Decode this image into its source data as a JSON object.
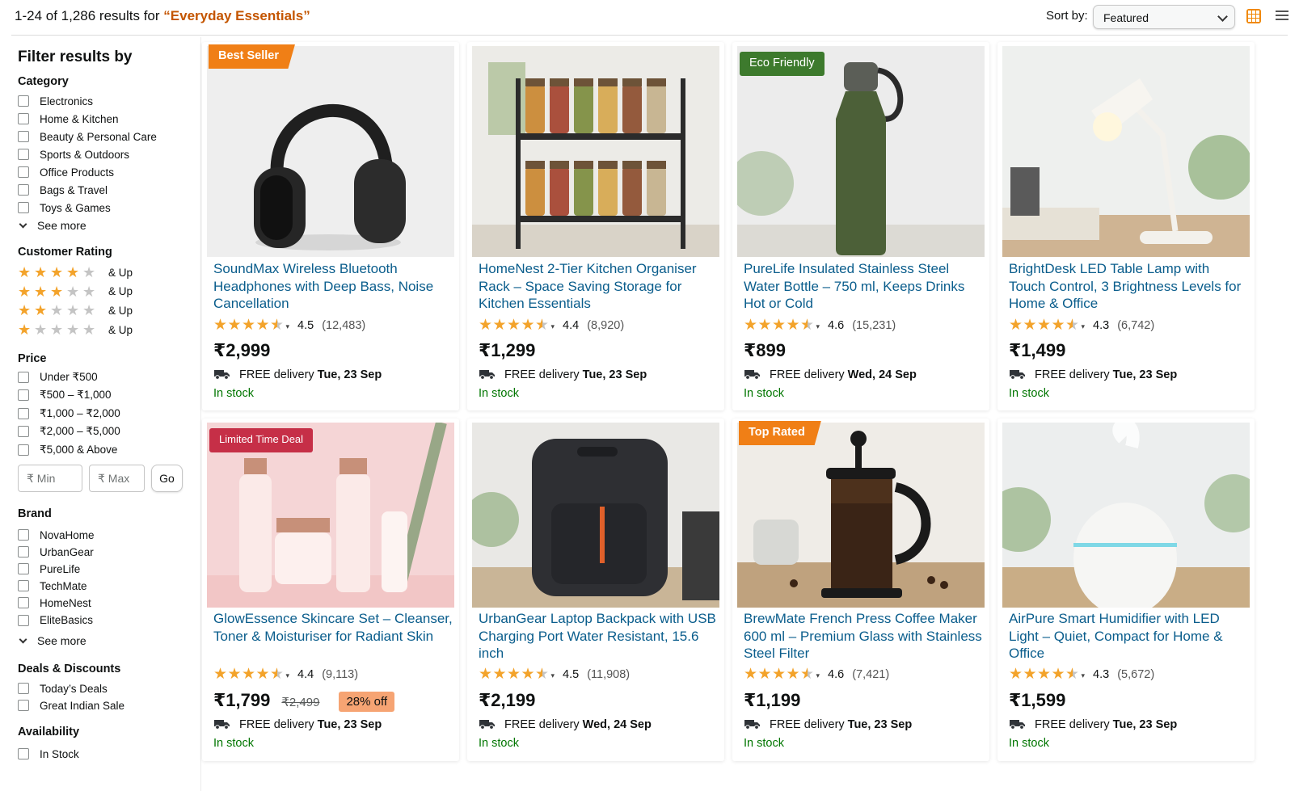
{
  "header": {
    "results_prefix": "1-24 of 1,286 results for ",
    "query": "“Everyday Essentials”",
    "sort_label": "Sort by:",
    "sort_value": "Featured",
    "view_active": "grid"
  },
  "sidebar": {
    "title": "Filter results by",
    "category": {
      "heading": "Category",
      "items": [
        "Electronics",
        "Home & Kitchen",
        "Beauty & Personal Care",
        "Sports & Outdoors",
        "Office Products",
        "Bags & Travel",
        "Toys & Games"
      ],
      "see_more": "See more"
    },
    "rating": {
      "heading": "Customer Rating",
      "items": [
        {
          "stars": 4,
          "label": "& Up"
        },
        {
          "stars": 3,
          "label": "& Up"
        },
        {
          "stars": 2,
          "label": "& Up"
        },
        {
          "stars": 1,
          "label": "& Up"
        }
      ]
    },
    "price": {
      "heading": "Price",
      "items": [
        "Under ₹500",
        "₹500 – ₹1,000",
        "₹1,000 – ₹2,000",
        "₹2,000 – ₹5,000",
        "₹5,000 & Above"
      ],
      "min_placeholder": "₹ Min",
      "max_placeholder": "₹ Max",
      "go": "Go"
    },
    "brand": {
      "heading": "Brand",
      "items": [
        "NovaHome",
        "UrbanGear",
        "PureLife",
        "TechMate",
        "HomeNest",
        "EliteBasics"
      ],
      "see_more": "See more"
    },
    "deals": {
      "heading": "Deals & Discounts",
      "items": [
        "Today’s Deals",
        "Great Indian Sale"
      ]
    },
    "availability": {
      "heading": "Availability",
      "items": [
        "In Stock"
      ]
    }
  },
  "products": [
    {
      "badge": "Best Seller",
      "badge_style": "orange",
      "title": "SoundMax Wireless Bluetooth Headphones with Deep Bass, Noise Cancellation",
      "rating": 4.5,
      "avg": "4.5",
      "count": "(12,483)",
      "price": "₹2,999",
      "was": "",
      "off": "",
      "delivery": "FREE delivery",
      "date": "Tue, 23 Sep",
      "stock": "In stock",
      "image": "headphones"
    },
    {
      "badge": "",
      "badge_style": "",
      "title": "HomeNest 2-Tier Kitchen Organiser Rack – Space Saving Storage for Kitchen Essentials",
      "rating": 4.4,
      "avg": "4.4",
      "count": "(8,920)",
      "price": "₹1,299",
      "was": "",
      "off": "",
      "delivery": "FREE delivery",
      "date": "Tue, 23 Sep",
      "stock": "In stock",
      "image": "spice-rack"
    },
    {
      "badge": "Eco Friendly",
      "badge_style": "green",
      "title": "PureLife Insulated Stainless Steel Water Bottle – 750 ml, Keeps Drinks Hot or Cold",
      "rating": 4.6,
      "avg": "4.6",
      "count": "(15,231)",
      "price": "₹899",
      "was": "",
      "off": "",
      "delivery": "FREE delivery",
      "date": "Wed, 24 Sep",
      "stock": "In stock",
      "image": "water-bottle"
    },
    {
      "badge": "",
      "badge_style": "",
      "title": "BrightDesk LED Table Lamp with Touch Control, 3 Brightness Levels for Home & Office",
      "rating": 4.3,
      "avg": "4.3",
      "count": "(6,742)",
      "price": "₹1,499",
      "was": "",
      "off": "",
      "delivery": "FREE delivery",
      "date": "Tue, 23 Sep",
      "stock": "In stock",
      "image": "desk-lamp"
    },
    {
      "badge": "Limited Time Deal",
      "badge_style": "red",
      "title": "GlowEssence Skincare Set – Cleanser, Toner & Moisturiser for Radiant Skin",
      "rating": 4.4,
      "avg": "4.4",
      "count": "(9,113)",
      "price": "₹1,799",
      "was": "₹2,499",
      "off": "28% off",
      "delivery": "FREE delivery",
      "date": "Tue, 23 Sep",
      "stock": "In stock",
      "image": "skincare"
    },
    {
      "badge": "",
      "badge_style": "",
      "title": "UrbanGear Laptop Backpack with USB Charging Port Water Resistant, 15.6 inch",
      "rating": 4.5,
      "avg": "4.5",
      "count": "(11,908)",
      "price": "₹2,199",
      "was": "",
      "off": "",
      "delivery": "FREE delivery",
      "date": "Wed, 24 Sep",
      "stock": "In stock",
      "image": "backpack"
    },
    {
      "badge": "Top Rated",
      "badge_style": "orange",
      "title": "BrewMate French Press Coffee Maker 600 ml – Premium Glass with Stainless Steel Filter",
      "rating": 4.6,
      "avg": "4.6",
      "count": "(7,421)",
      "price": "₹1,199",
      "was": "",
      "off": "",
      "delivery": "FREE delivery",
      "date": "Tue, 23 Sep",
      "stock": "In stock",
      "image": "french-press"
    },
    {
      "badge": "",
      "badge_style": "",
      "title": "AirPure Smart Humidifier with LED Light – Quiet, Compact for Home & Office",
      "rating": 4.3,
      "avg": "4.3",
      "count": "(5,672)",
      "price": "₹1,599",
      "was": "",
      "off": "",
      "delivery": "FREE delivery",
      "date": "Tue, 23 Sep",
      "stock": "In stock",
      "image": "humidifier"
    }
  ]
}
